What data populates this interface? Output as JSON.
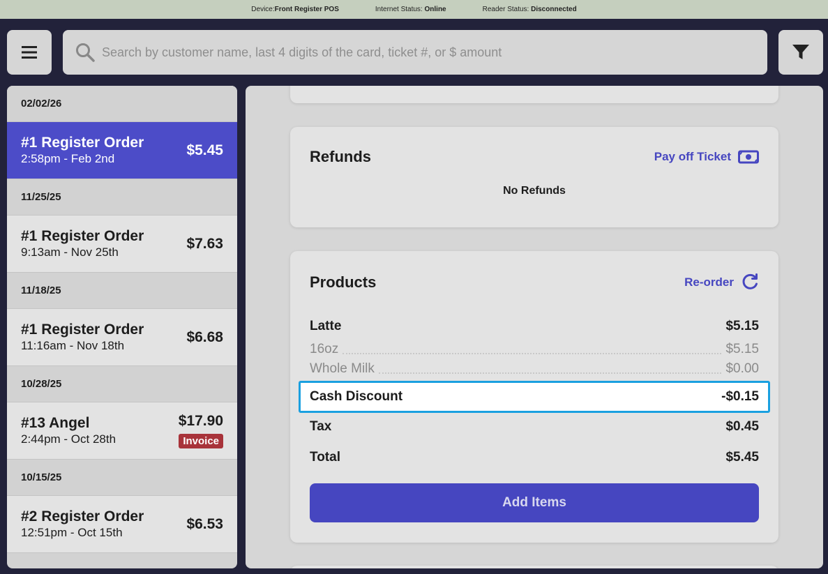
{
  "status_bar": {
    "device_label": "Device:",
    "device_value": "Front Register POS",
    "internet_label": "Internet Status:",
    "internet_value": "Online",
    "reader_label": "Reader Status:",
    "reader_value": "Disconnected"
  },
  "search": {
    "placeholder": "Search by customer name, last 4 digits of the card, ticket #, or $ amount"
  },
  "tickets": [
    {
      "date": "02/02/26",
      "name": "#1 Register Order",
      "time": "2:58pm - Feb 2nd",
      "amount": "$5.45",
      "selected": true
    },
    {
      "date": "11/25/25",
      "name": "#1 Register Order",
      "time": "9:13am - Nov 25th",
      "amount": "$7.63"
    },
    {
      "date": "11/18/25",
      "name": "#1 Register Order",
      "time": "11:16am - Nov 18th",
      "amount": "$6.68"
    },
    {
      "date": "10/28/25",
      "name": "#13 Angel",
      "time": "2:44pm - Oct 28th",
      "amount": "$17.90",
      "badge": "Invoice"
    },
    {
      "date": "10/15/25",
      "name": "#2 Register Order",
      "time": "12:51pm - Oct 15th",
      "amount": "$6.53"
    }
  ],
  "refunds": {
    "title": "Refunds",
    "action": "Pay off Ticket",
    "empty": "No Refunds"
  },
  "products": {
    "title": "Products",
    "action": "Re-order",
    "item": {
      "name": "Latte",
      "price": "$5.15"
    },
    "modifiers": [
      {
        "name": "16oz",
        "price": "$5.15"
      },
      {
        "name": "Whole Milk",
        "price": "$0.00"
      }
    ],
    "discount": {
      "label": "Cash Discount",
      "value": "-$0.15"
    },
    "tax": {
      "label": "Tax",
      "value": "$0.45"
    },
    "total": {
      "label": "Total",
      "value": "$5.45"
    },
    "add_button": "Add Items"
  },
  "colors": {
    "accent": "#4646c0",
    "selected_row": "#4c4cc8",
    "invoice_badge": "#a8333a",
    "highlight_border": "#1aa0e0"
  }
}
